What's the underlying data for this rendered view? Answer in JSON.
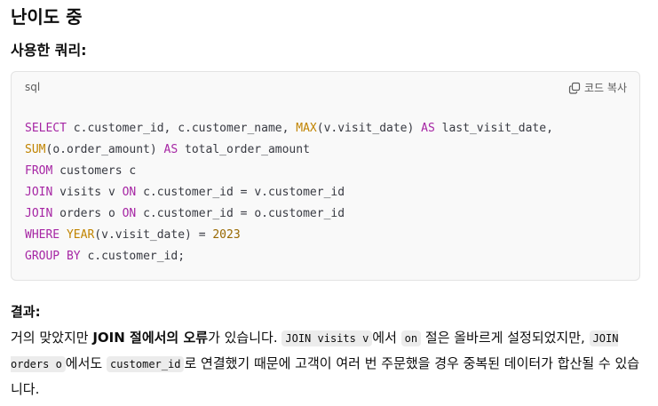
{
  "page": {
    "difficulty_heading": "난이도 중",
    "query_heading": "사용한 쿼리:"
  },
  "code_block": {
    "language": "sql",
    "copy_label": "코드 복사",
    "copy_icon": "copy-icon",
    "lines": [
      "SELECT c.customer_id, c.customer_name, MAX(v.visit_date) AS last_visit_date,",
      "SUM(o.order_amount) AS total_order_amount",
      "FROM customers c",
      "JOIN visits v ON c.customer_id = v.customer_id",
      "JOIN orders o ON c.customer_id = o.customer_id",
      "WHERE YEAR(v.visit_date) = 2023",
      "GROUP BY c.customer_id;"
    ]
  },
  "result": {
    "heading": "결과:",
    "p1": "거의 맞았지만 ",
    "p2_bold": "JOIN 절에서의 오류",
    "p3": "가 있습니다. ",
    "code1": "JOIN visits v",
    "p4": "에서 ",
    "code2": "on",
    "p5": " 절은 올바르게 설정되었지만, ",
    "code3": "JOIN orders o",
    "p6": "에서도 ",
    "code4": "customer_id",
    "p7": "로 연결했기 때문에 고객이 여러 번 주문했을 경우 중복된 데이터가 합산될 수 있습니다."
  },
  "colors": {
    "keyword": "#a626a4",
    "function": "#c18401",
    "number": "#986801",
    "code_bg": "#f9f9f9"
  }
}
